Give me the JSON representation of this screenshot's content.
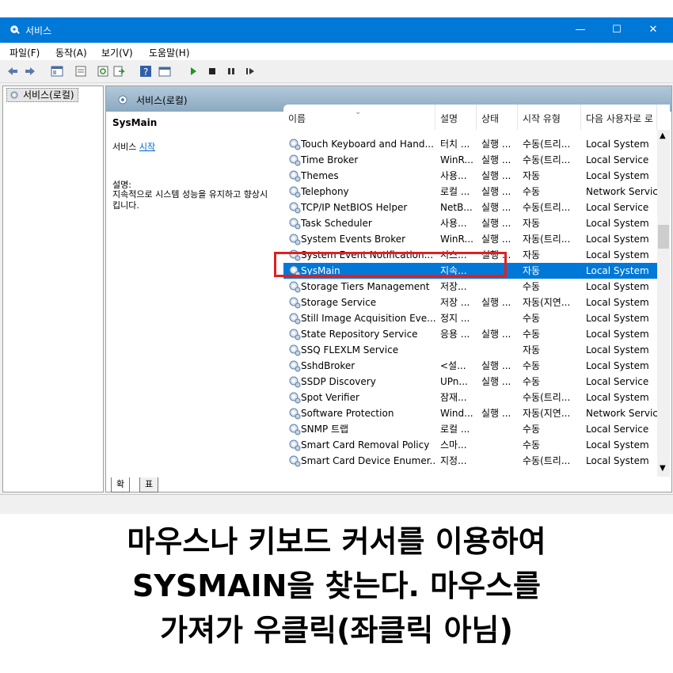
{
  "window": {
    "title": "서비스"
  },
  "menu": [
    "파일(F)",
    "동작(A)",
    "보기(V)",
    "도움말(H)"
  ],
  "tree": {
    "root": "서비스(로컬)"
  },
  "main_header": "서비스(로컬)",
  "description": {
    "service_name": "SysMain",
    "action_prefix": "서비스 ",
    "action_link": "시작",
    "desc_label": "설명:",
    "desc_text": "지속적으로 시스템 성능을 유지하고 향상시킵니다."
  },
  "columns": [
    "이름",
    "설명",
    "상태",
    "시작 유형",
    "다음 사용자로 로"
  ],
  "rows": [
    {
      "name": "Touch Keyboard and Hand...",
      "desc": "터치 ...",
      "status": "실행 ...",
      "startup": "수동(트리...",
      "logon": "Local System"
    },
    {
      "name": "Time Broker",
      "desc": "WinR...",
      "status": "실행 ...",
      "startup": "수동(트리...",
      "logon": "Local Service"
    },
    {
      "name": "Themes",
      "desc": "사용...",
      "status": "실행 ...",
      "startup": "자동",
      "logon": "Local System"
    },
    {
      "name": "Telephony",
      "desc": "로컬 ...",
      "status": "실행 ...",
      "startup": "수동",
      "logon": "Network Service"
    },
    {
      "name": "TCP/IP NetBIOS Helper",
      "desc": "NetB...",
      "status": "실행 ...",
      "startup": "수동(트리...",
      "logon": "Local Service"
    },
    {
      "name": "Task Scheduler",
      "desc": "사용...",
      "status": "실행 ...",
      "startup": "자동",
      "logon": "Local System"
    },
    {
      "name": "System Events Broker",
      "desc": "WinR...",
      "status": "실행 ...",
      "startup": "자동(트리...",
      "logon": "Local System"
    },
    {
      "name": "System Event Notification...",
      "desc": "시스...",
      "status": "실행 ...",
      "startup": "자동",
      "logon": "Local System"
    },
    {
      "name": "SysMain",
      "desc": "지속...",
      "status": "",
      "startup": "자동",
      "logon": "Local System",
      "selected": true
    },
    {
      "name": "Storage Tiers Management",
      "desc": "저장...",
      "status": "",
      "startup": "수동",
      "logon": "Local System"
    },
    {
      "name": "Storage Service",
      "desc": "저장 ...",
      "status": "실행 ...",
      "startup": "자동(지연...",
      "logon": "Local System"
    },
    {
      "name": "Still Image Acquisition Eve...",
      "desc": "정지 ...",
      "status": "",
      "startup": "수동",
      "logon": "Local System"
    },
    {
      "name": "State Repository Service",
      "desc": "응용 ...",
      "status": "실행 ...",
      "startup": "수동",
      "logon": "Local System"
    },
    {
      "name": "SSQ FLEXLM Service",
      "desc": "",
      "status": "",
      "startup": "자동",
      "logon": "Local System"
    },
    {
      "name": "SshdBroker",
      "desc": "<설...",
      "status": "실행 ...",
      "startup": "수동",
      "logon": "Local System"
    },
    {
      "name": "SSDP Discovery",
      "desc": "UPn...",
      "status": "실행 ...",
      "startup": "수동",
      "logon": "Local Service"
    },
    {
      "name": "Spot Verifier",
      "desc": "잠재...",
      "status": "",
      "startup": "수동(트리...",
      "logon": "Local System"
    },
    {
      "name": "Software Protection",
      "desc": "Wind...",
      "status": "실행 ...",
      "startup": "자동(지연...",
      "logon": "Network Service"
    },
    {
      "name": "SNMP 트랩",
      "desc": "로컬 ...",
      "status": "",
      "startup": "수동",
      "logon": "Local Service"
    },
    {
      "name": "Smart Card Removal Policy",
      "desc": "스마...",
      "status": "",
      "startup": "수동",
      "logon": "Local System"
    },
    {
      "name": "Smart Card Device Enumer...",
      "desc": "지정...",
      "status": "",
      "startup": "수동(트리...",
      "logon": "Local System"
    }
  ],
  "tabs": [
    "확장",
    "표준"
  ],
  "caption": [
    "마우스나 키보드 커서를 이용하여",
    "SYSMAIN을 찾는다. 마우스를",
    "가져가 우클릭(좌클릭 아님)"
  ],
  "colors": {
    "titlebar": "#0078d7",
    "selection": "#0078d7",
    "highlight_box": "#e02020"
  }
}
